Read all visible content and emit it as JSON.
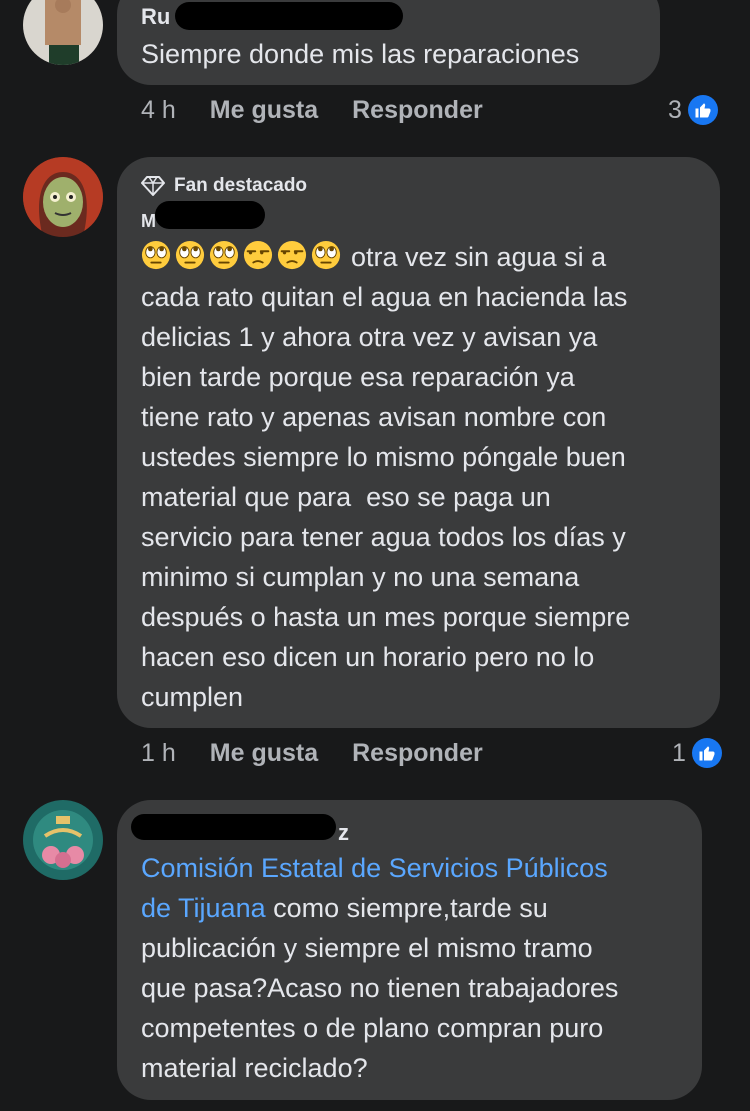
{
  "comments": [
    {
      "author_visible": "Ru",
      "text": "Siempre donde mis las reparaciones",
      "time": "4 h",
      "like_label": "Me gusta",
      "reply_label": "Responder",
      "reactions": "3"
    },
    {
      "badge": "Fan destacado",
      "author_visible": "M",
      "emojis": [
        "eye-roll",
        "eye-roll",
        "eye-roll",
        "unamused",
        "unamused",
        "eye-roll"
      ],
      "text_lines": [
        "otra vez sin agua si a",
        "cada rato quitan el agua en hacienda las",
        "delicias 1 y ahora otra vez y avisan ya",
        "bien tarde porque esa reparación ya",
        "tiene rato y apenas avisan nombre con",
        "ustedes siempre lo mismo póngale buen",
        "material que para  eso se paga un",
        "servicio para tener agua todos los días y",
        "minimo si cumplan y no una semana",
        "después o hasta un mes porque siempre",
        "hacen eso dicen un horario pero no lo",
        "cumplen"
      ],
      "time": "1 h",
      "like_label": "Me gusta",
      "reply_label": "Responder",
      "reactions": "1"
    },
    {
      "author_visible": "z",
      "mention_line1": "Comisión Estatal de Servicios Públicos",
      "mention_line2": "de Tijuana",
      "text_line2_rest": " como siempre,tarde su",
      "text_lines": [
        "publicación y siempre el mismo tramo",
        "que pasa?Acaso no tienen trabajadores",
        "competentes o de plano compran puro",
        "material reciclado?"
      ]
    }
  ],
  "colors": {
    "background": "#18191a",
    "bubble": "#3a3b3c",
    "link": "#5aa7ff",
    "like_blue": "#1877f2"
  }
}
